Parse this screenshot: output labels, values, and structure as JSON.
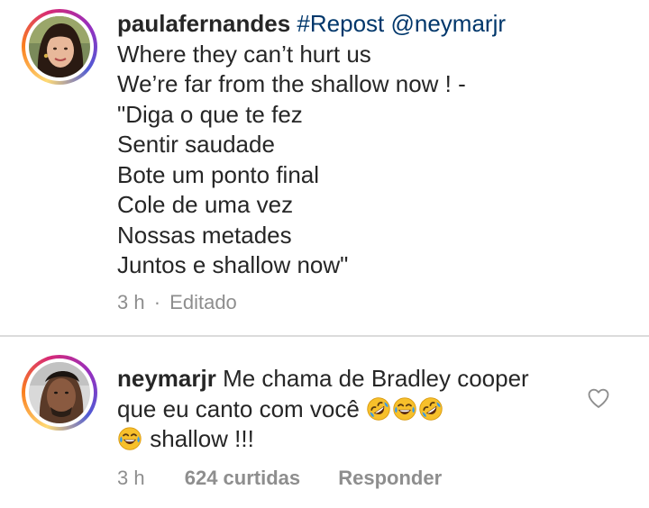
{
  "post": {
    "username": "paulafernandes",
    "hashtag": "#Repost",
    "mention": "@neymarjr",
    "lines": [
      "Where they can’t hurt us",
      "We’re far from the shallow now ! -",
      "\"Diga o que te fez",
      "Sentir saudade",
      "Bote um ponto final",
      "Cole de uma vez",
      "Nossas metades",
      "Juntos e shallow now\""
    ],
    "time": "3 h",
    "separator": "·",
    "edited_label": "Editado"
  },
  "comment": {
    "username": "neymarjr",
    "line1": "Me chama de Bradley cooper",
    "line2": "que eu canto com você",
    "line3": "shallow !!!",
    "time": "3 h",
    "likes": "624 curtidas",
    "reply_label": "Responder",
    "emojis_line2": [
      "rolling-on-floor-laughing-emoji",
      "tears-of-joy-emoji",
      "rolling-on-floor-laughing-emoji"
    ],
    "emojis_line3": [
      "tears-of-joy-emoji"
    ]
  },
  "colors": {
    "text": "#262626",
    "link": "#00376b",
    "meta": "#8e8e8e",
    "divider": "#dbdbdb",
    "emoji_face": "#f7c02b",
    "emoji_tear": "#3a9be6"
  }
}
